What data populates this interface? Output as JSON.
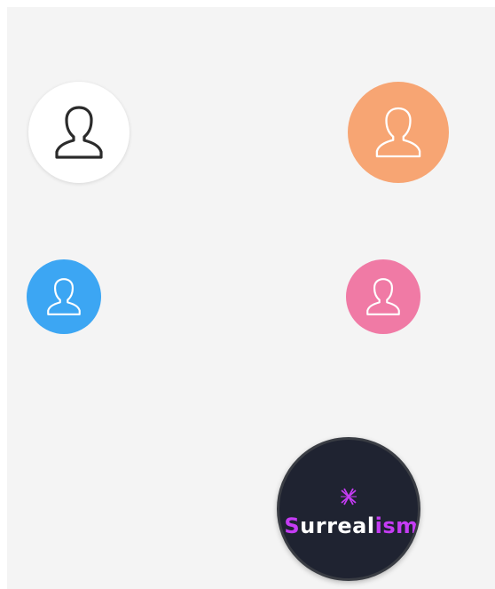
{
  "avatars": [
    {
      "id": "white",
      "icon": "user-icon",
      "background": "#ffffff",
      "stroke": "#2b2b2b"
    },
    {
      "id": "orange",
      "icon": "user-icon",
      "background": "#f7a573",
      "stroke": "#ffffff"
    },
    {
      "id": "blue",
      "icon": "user-icon",
      "background": "#3ca6f3",
      "stroke": "#ffffff"
    },
    {
      "id": "pink",
      "icon": "user-icon",
      "background": "#f07aa5",
      "stroke": "#ffffff"
    }
  ],
  "logo_avatar": {
    "icon": "surrealism-logo-icon",
    "background": "#1f2331",
    "accent": "#c53cf4",
    "text_start": "S",
    "text_mid": "urreal",
    "text_end": "ism"
  }
}
